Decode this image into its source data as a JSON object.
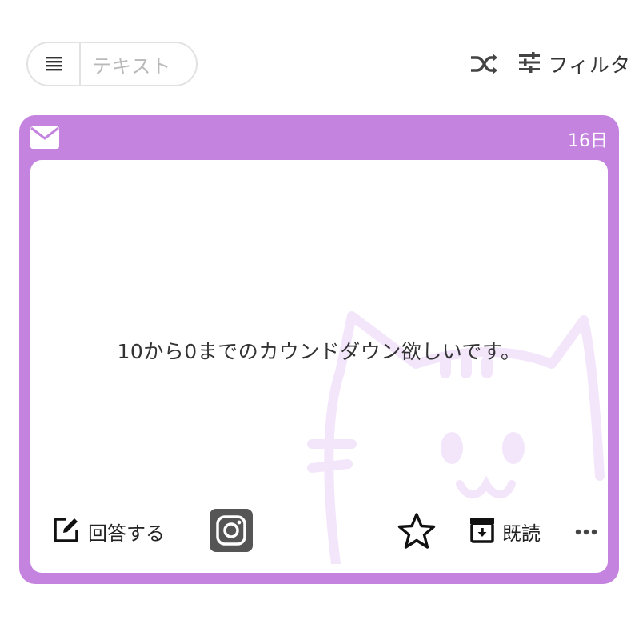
{
  "toolbar": {
    "view_toggle_icon": "list-icon",
    "search_placeholder": "テキスト",
    "shuffle_icon": "shuffle-icon",
    "filter_icon": "sliders-icon",
    "filter_label": "フィルタ"
  },
  "card": {
    "header_icon": "mail-icon",
    "date": "16日",
    "message": "10から0までのカウンドダウン欲しいです。",
    "colors": {
      "accent": "#c583e0",
      "watermark": "#f3e7fa"
    },
    "actions": {
      "answer_label": "回答する",
      "answer_icon": "edit-icon",
      "instagram_icon": "instagram-icon",
      "star_icon": "star-icon",
      "read_label": "既読",
      "read_icon": "archive-icon",
      "more_icon": "more-icon"
    }
  }
}
